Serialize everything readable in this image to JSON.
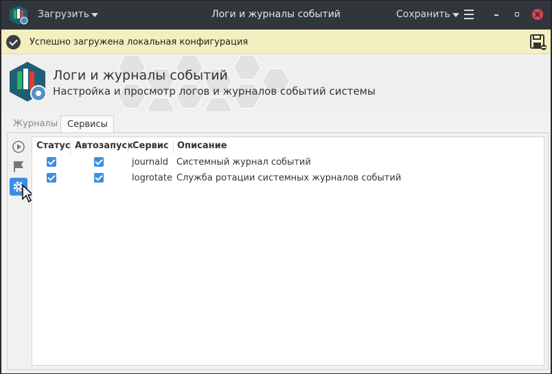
{
  "titlebar": {
    "load_label": "Загрузить",
    "window_title": "Логи и журналы событий",
    "save_label": "Сохранить"
  },
  "notice": {
    "text": "Успешно загружена локальная конфигурация"
  },
  "header": {
    "title": "Логи и журналы событий",
    "subtitle": "Настройка и просмотр логов и журналов событий системы"
  },
  "tabs": [
    {
      "label": "Журналы",
      "active": false
    },
    {
      "label": "Сервисы",
      "active": true
    }
  ],
  "table": {
    "columns": [
      "Статус",
      "Автозапуск",
      "Сервис",
      "Описание"
    ],
    "rows": [
      {
        "status": true,
        "autostart": true,
        "service": "journald",
        "description": "Системный журнал событий"
      },
      {
        "status": true,
        "autostart": true,
        "service": "logrotate",
        "description": "Служба ротации системных журналов событий"
      }
    ]
  },
  "colors": {
    "titlebar_bg": "#31363b",
    "accent": "#3d8de2",
    "notice_bg": "#f3efbf",
    "close_red": "#da4453"
  },
  "icons": [
    "app-logo-icon",
    "play-icon",
    "flag-icon",
    "gear-icon",
    "save-disk-icon",
    "check-icon",
    "hamburger-menu-icon"
  ]
}
